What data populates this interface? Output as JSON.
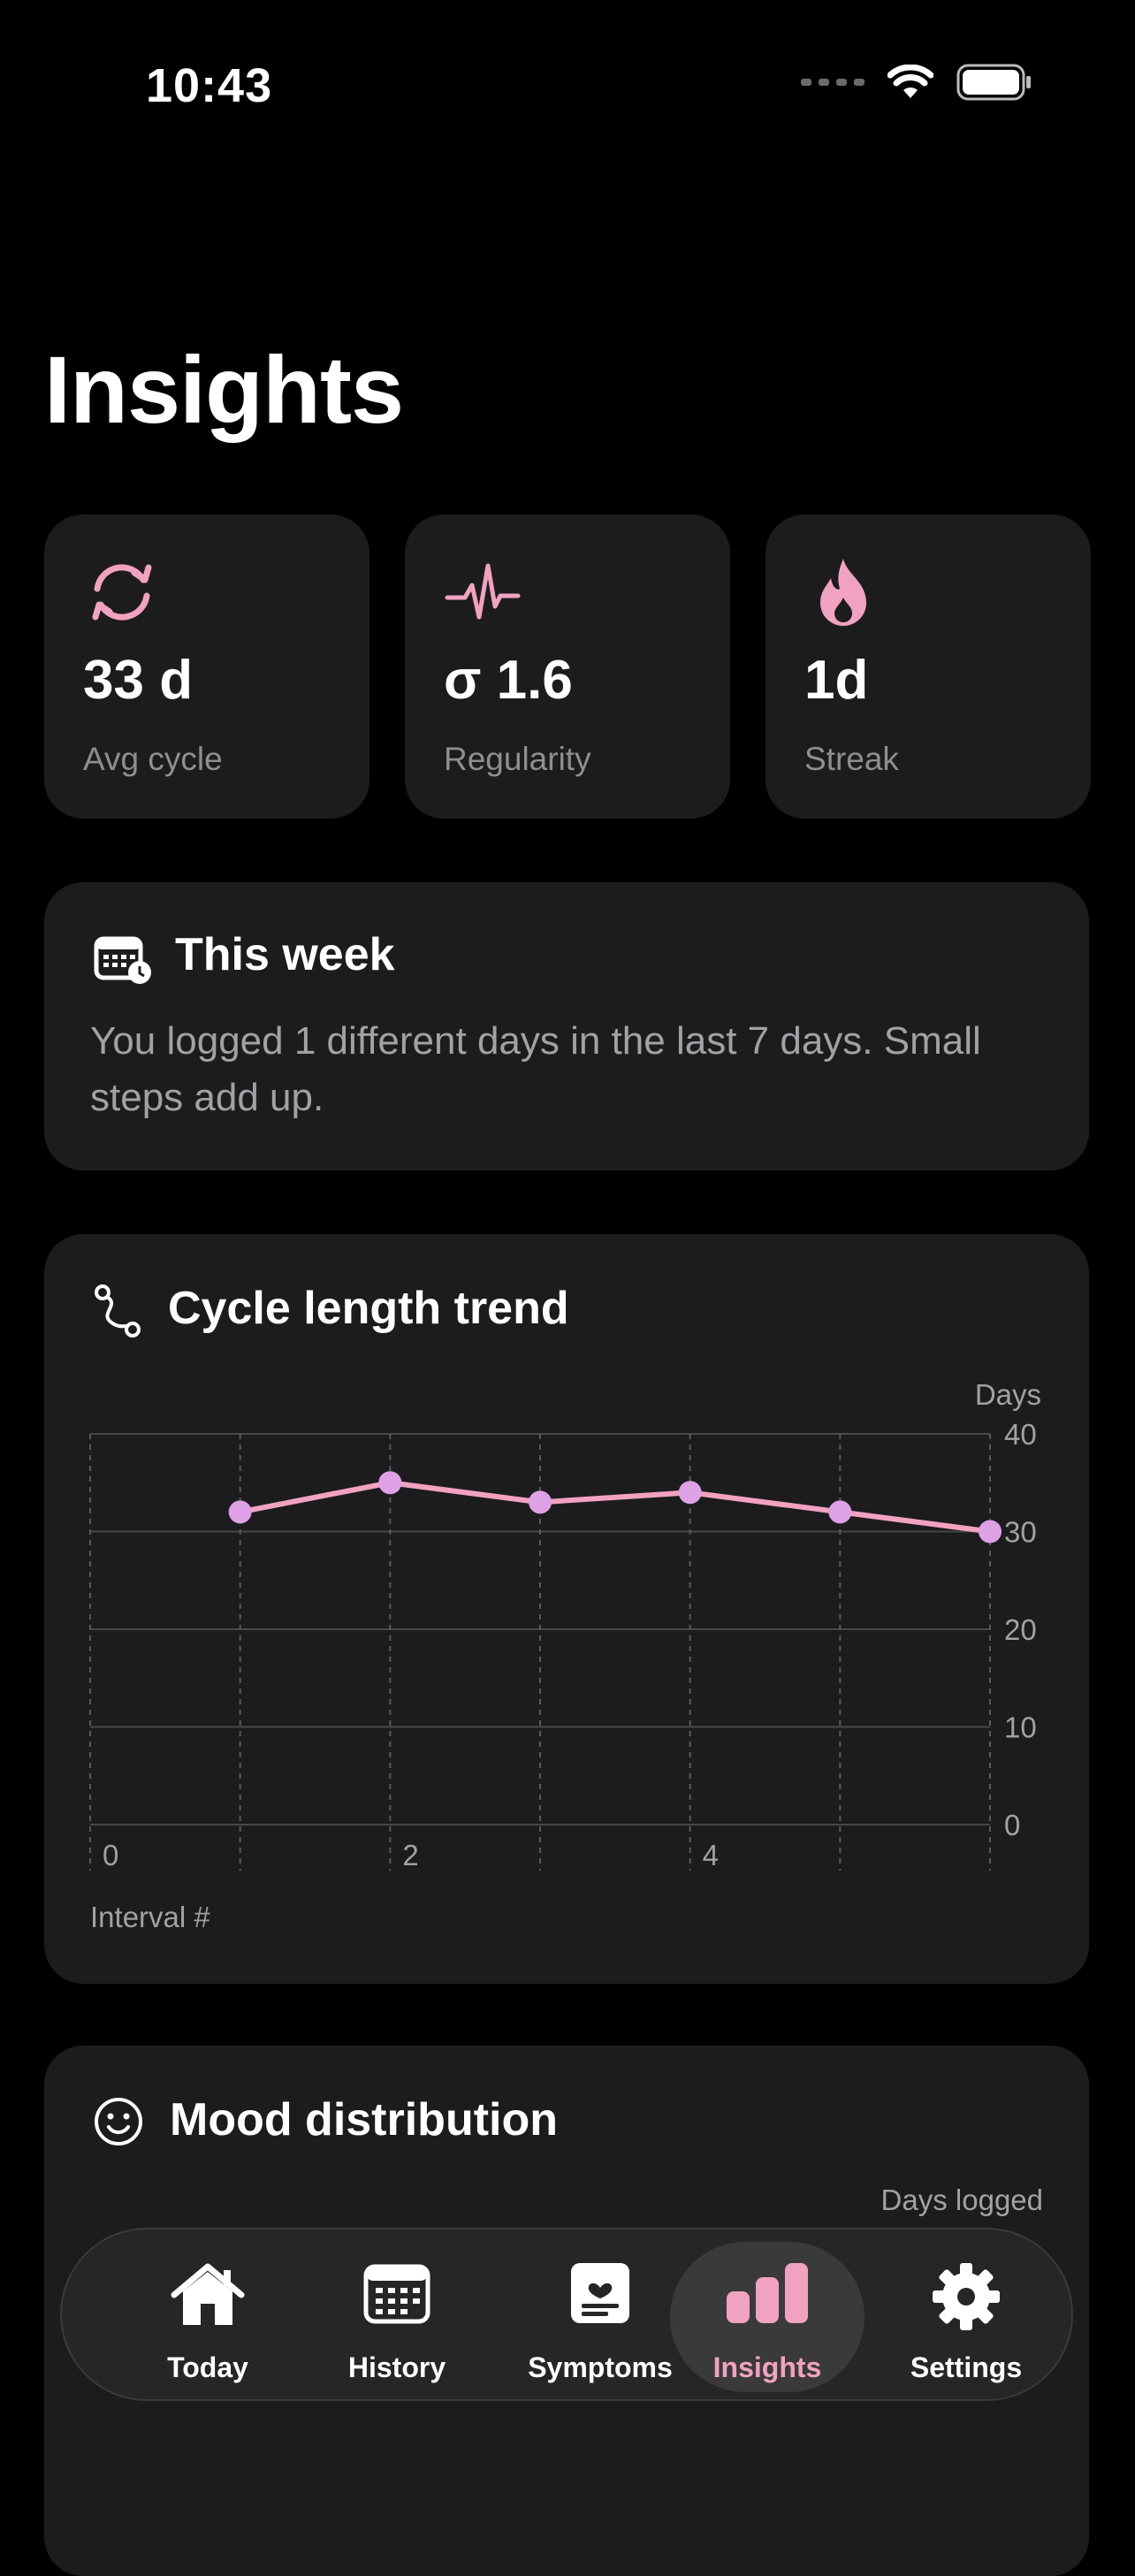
{
  "status": {
    "time": "10:43"
  },
  "title": "Insights",
  "stats": [
    {
      "value": "33 d",
      "label": "Avg cycle",
      "icon": "cycle-arrows-icon"
    },
    {
      "value": "σ 1.6",
      "label": "Regularity",
      "icon": "waveform-icon"
    },
    {
      "value": "1d",
      "label": "Streak",
      "icon": "flame-icon"
    }
  ],
  "week": {
    "title": "This week",
    "text": "You logged 1 different days in the last 7 days. Small steps add up.",
    "icon": "calendar-clock-icon"
  },
  "trend": {
    "title": "Cycle length trend",
    "icon": "path-icon"
  },
  "chart_data": {
    "type": "line",
    "x": [
      1,
      2,
      3,
      4,
      5,
      6
    ],
    "series": [
      {
        "values": [
          32,
          35,
          33,
          34,
          32,
          30
        ]
      }
    ],
    "xlabel": "Interval #",
    "ylabel": "Days",
    "xlim": [
      0,
      6
    ],
    "ylim": [
      0,
      40
    ],
    "xticks": [
      0,
      2,
      4
    ],
    "yticks": [
      0,
      10,
      20,
      30,
      40
    ],
    "grid": true,
    "colors": {
      "line": "#f2a2c1",
      "point": "#dfa1e6"
    }
  },
  "mood": {
    "title": "Mood distribution",
    "ylabel": "Days logged",
    "icon": "smiley-icon"
  },
  "tabs": [
    {
      "label": "Today",
      "icon": "house-icon"
    },
    {
      "label": "History",
      "icon": "calendar-icon"
    },
    {
      "label": "Symptoms",
      "icon": "heart-clipboard-icon"
    },
    {
      "label": "Insights",
      "icon": "bar-chart-icon",
      "active": true
    },
    {
      "label": "Settings",
      "icon": "gear-icon"
    }
  ],
  "colors": {
    "accent": "#f2a2c1",
    "card": "#1c1c1e",
    "secondary": "#8e8e93"
  }
}
